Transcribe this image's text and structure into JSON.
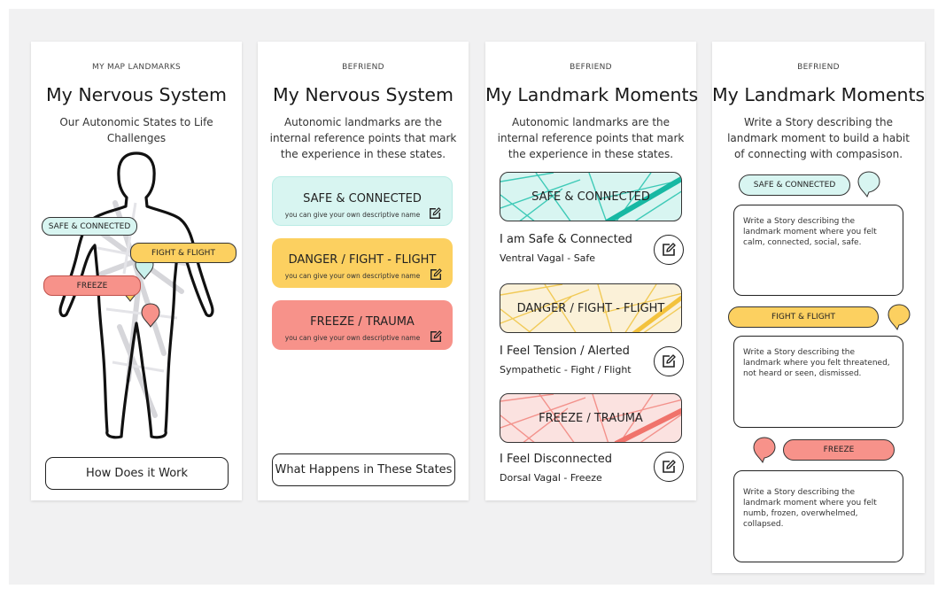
{
  "colors": {
    "safe": "#d8f5f1",
    "safe_accent": "#24c2ad",
    "fight": "#fcd060",
    "fight_accent": "#f0c64a",
    "freeze": "#f7928a",
    "freeze_accent": "#f1837c"
  },
  "screen1": {
    "eyebrow": "MY MAP LANDMARKS",
    "title": "My Nervous System",
    "subtitle": "Our Autonomic States to Life Challenges",
    "tags": {
      "safe": "SAFE & CONNECTED",
      "fight": "FIGHT & FLIGHT",
      "freeze": "FREEZE"
    },
    "button": "How Does it Work"
  },
  "screen2": {
    "eyebrow": "BEFRIEND",
    "title": "My Nervous System",
    "subtitle": "Autonomic landmarks are the internal reference points that mark the experience in these states.",
    "states": [
      {
        "label": "SAFE & CONNECTED",
        "hint": "you can give your own descriptive name",
        "icon": "edit-icon"
      },
      {
        "label": "DANGER / FIGHT - FLIGHT",
        "hint": "you can give your own descriptive name",
        "icon": "edit-icon"
      },
      {
        "label": "FREEZE / TRAUMA",
        "hint": "you can give your own descriptive name",
        "icon": "edit-icon"
      }
    ],
    "button": "What Happens in These States"
  },
  "screen3": {
    "eyebrow": "BEFRIEND",
    "title": "My Landmark Moments",
    "subtitle": "Autonomic landmarks are the internal reference points that mark the experience in these states.",
    "landmarks": [
      {
        "label": "SAFE & CONNECTED",
        "line1": "I am Safe & Connected",
        "line2": "Ventral Vagal - Safe"
      },
      {
        "label": "DANGER / FIGHT - FLIGHT",
        "line1": "I Feel Tension / Alerted",
        "line2": "Sympathetic - Fight / Flight"
      },
      {
        "label": "FREEZE / TRAUMA",
        "line1": "I Feel Disconnected",
        "line2": "Dorsal Vagal - Freeze"
      }
    ]
  },
  "screen4": {
    "eyebrow": "BEFRIEND",
    "title": "My Landmark Moments",
    "subtitle": "Write a Story describing the landmark moment to build a habit of connecting with compasison.",
    "stories": [
      {
        "pill": "SAFE & CONNECTED",
        "text": "Write a Story describing the landmark moment where you felt calm, connected, social, safe."
      },
      {
        "pill": "FIGHT & FLIGHT",
        "text": "Write a Story describing the landmark where you felt threatened, not heard or seen, dismissed."
      },
      {
        "pill": "FREEZE",
        "text": "Write a Story describing the landmark moment where you felt numb, frozen, overwhelmed, collapsed."
      }
    ]
  }
}
